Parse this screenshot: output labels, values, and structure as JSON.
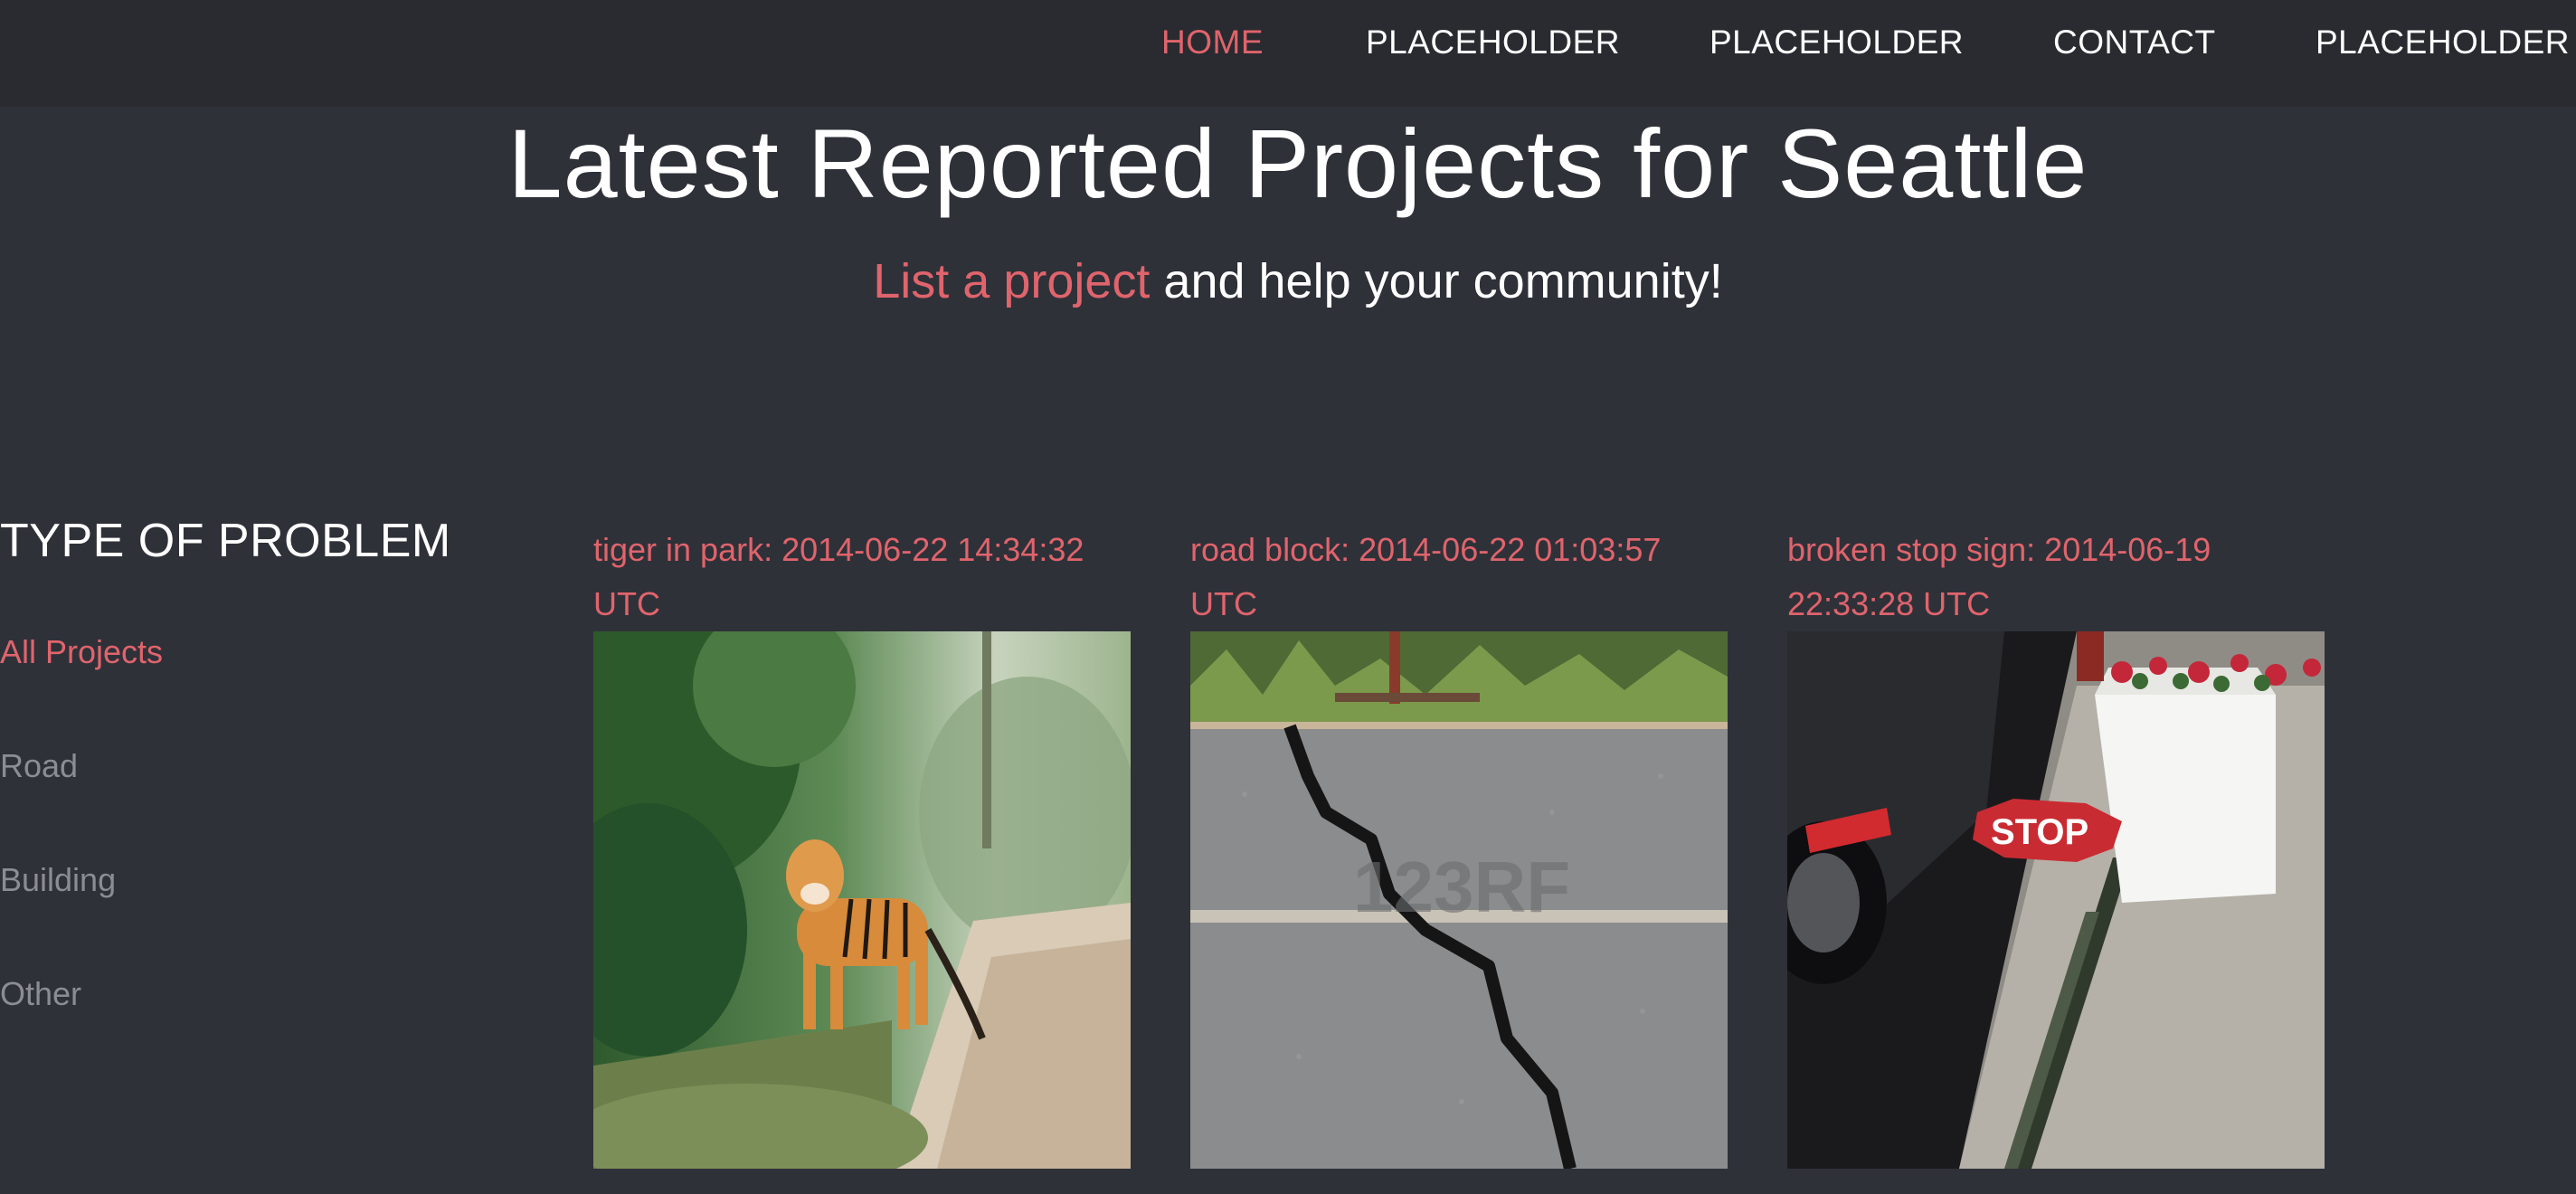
{
  "nav": {
    "items": [
      {
        "label": "HOME",
        "active": true
      },
      {
        "label": "PLACEHOLDER",
        "active": false
      },
      {
        "label": "PLACEHOLDER",
        "active": false
      },
      {
        "label": "CONTACT",
        "active": false
      },
      {
        "label": "PLACEHOLDER",
        "active": false
      }
    ]
  },
  "header": {
    "title": "Latest Reported Projects for Seattle",
    "tagline_link": "List a project",
    "tagline_rest": " and help your community!"
  },
  "sidebar": {
    "heading": "TYPE OF PROBLEM",
    "items": [
      {
        "label": "All Projects",
        "active": true
      },
      {
        "label": "Road",
        "active": false
      },
      {
        "label": "Building",
        "active": false
      },
      {
        "label": "Other",
        "active": false
      }
    ]
  },
  "projects": [
    {
      "title": "tiger in park: 2014-06-22 14:34:32 UTC",
      "image": "tiger-on-dirt-path-photo"
    },
    {
      "title": "road block: 2014-06-22 01:03:57 UTC",
      "image": "cracked-asphalt-road-photo"
    },
    {
      "title": "broken stop sign: 2014-06-19 22:33:28 UTC",
      "image": "fallen-stop-sign-photo"
    }
  ],
  "colors": {
    "background": "#2f3139",
    "navbar": "#292b30",
    "accent": "#e0646c",
    "muted": "#8a8d92"
  }
}
